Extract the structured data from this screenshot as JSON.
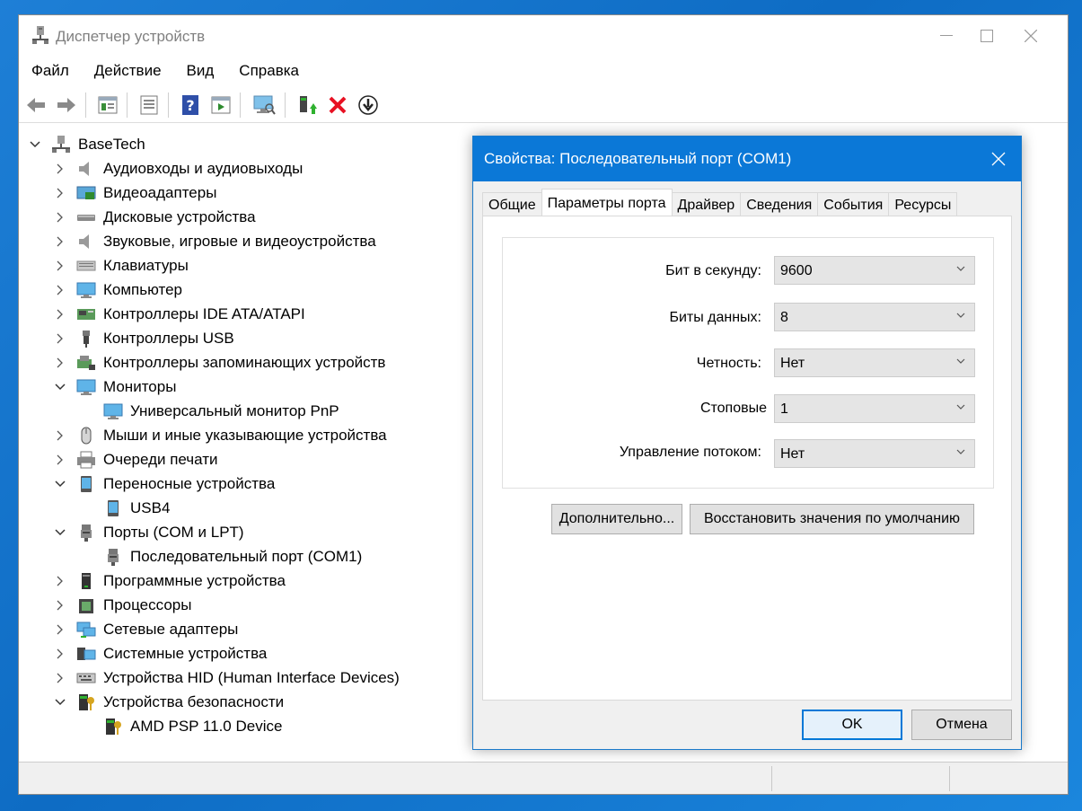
{
  "window": {
    "title": "Диспетчер устройств",
    "controls": {
      "minimize": "—",
      "maximize": "☐",
      "close": "✕"
    }
  },
  "menu": [
    "Файл",
    "Действие",
    "Вид",
    "Справка"
  ],
  "toolbar_icons": [
    "back-icon",
    "forward-icon",
    "properties-view-icon",
    "device-list-icon",
    "help-icon",
    "run-icon",
    "scan-hardware-icon",
    "enable-device-icon",
    "uninstall-icon",
    "update-driver-icon"
  ],
  "tree": {
    "root": "BaseTech",
    "items": [
      {
        "label": "Аудиовходы и аудиовыходы",
        "expanded": false,
        "icon": "speaker-icon"
      },
      {
        "label": "Видеоадаптеры",
        "expanded": false,
        "icon": "display-adapter-icon"
      },
      {
        "label": "Дисковые устройства",
        "expanded": false,
        "icon": "disk-icon"
      },
      {
        "label": "Звуковые, игровые и видеоустройства",
        "expanded": false,
        "icon": "speaker-icon"
      },
      {
        "label": "Клавиатуры",
        "expanded": false,
        "icon": "keyboard-icon"
      },
      {
        "label": "Компьютер",
        "expanded": false,
        "icon": "computer-icon"
      },
      {
        "label": "Контроллеры IDE ATA/ATAPI",
        "expanded": false,
        "icon": "ide-controller-icon"
      },
      {
        "label": "Контроллеры USB",
        "expanded": false,
        "icon": "usb-icon"
      },
      {
        "label": "Контроллеры запоминающих устройств",
        "expanded": false,
        "icon": "storage-controller-icon"
      },
      {
        "label": "Мониторы",
        "expanded": true,
        "icon": "monitor-icon"
      },
      {
        "label": "Универсальный монитор PnP",
        "child": true,
        "icon": "monitor-icon"
      },
      {
        "label": "Мыши и иные указывающие устройства",
        "expanded": false,
        "icon": "mouse-icon"
      },
      {
        "label": "Очереди печати",
        "expanded": false,
        "icon": "printer-icon"
      },
      {
        "label": "Переносные устройства",
        "expanded": true,
        "icon": "portable-device-icon"
      },
      {
        "label": "USB4",
        "child": true,
        "icon": "portable-device-icon"
      },
      {
        "label": "Порты (COM и LPT)",
        "expanded": true,
        "icon": "port-icon"
      },
      {
        "label": "Последовательный порт (COM1)",
        "child": true,
        "icon": "port-icon"
      },
      {
        "label": "Программные устройства",
        "expanded": false,
        "icon": "software-device-icon"
      },
      {
        "label": "Процессоры",
        "expanded": false,
        "icon": "processor-icon"
      },
      {
        "label": "Сетевые адаптеры",
        "expanded": false,
        "icon": "network-adapter-icon"
      },
      {
        "label": "Системные устройства",
        "expanded": false,
        "icon": "system-device-icon"
      },
      {
        "label": "Устройства HID (Human Interface Devices)",
        "expanded": false,
        "icon": "hid-icon"
      },
      {
        "label": "Устройства безопасности",
        "expanded": true,
        "icon": "security-device-icon"
      },
      {
        "label": "AMD PSP 11.0 Device",
        "child": true,
        "icon": "security-device-icon"
      }
    ]
  },
  "dialog": {
    "title": "Свойства: Последовательный порт (COM1)",
    "tabs": [
      "Общие",
      "Параметры порта",
      "Драйвер",
      "Сведения",
      "События",
      "Ресурсы"
    ],
    "active_tab": "Параметры порта",
    "fields": [
      {
        "label": "Бит в секунду:",
        "value": "9600"
      },
      {
        "label": "Биты данных:",
        "value": "8"
      },
      {
        "label": "Четность:",
        "value": "Нет"
      },
      {
        "label": "Стоповые",
        "value": "1"
      },
      {
        "label": "Управление потоком:",
        "value": "Нет"
      }
    ],
    "advanced_button": "Дополнительно...",
    "restore_button": "Восстановить значения по умолчанию",
    "ok_button": "OK",
    "cancel_button": "Отмена"
  },
  "colors": {
    "desktop": "#1e7fd6",
    "dialog_title": "#0b78d7",
    "accent": "#0078d7",
    "uninstall_red": "#e81123"
  }
}
